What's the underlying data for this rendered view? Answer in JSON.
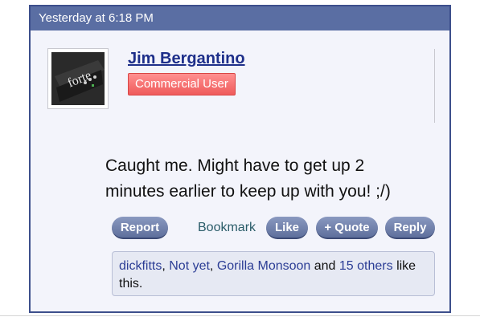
{
  "post": {
    "timestamp": "Yesterday at 6:18 PM",
    "author": {
      "name": "Jim Bergantino",
      "badge": "Commercial User",
      "avatar_icon": "amp-device-photo"
    },
    "message": "Caught me. Might have to get up 2 minutes earlier to keep up with you! ;/)",
    "actions": {
      "report": "Report",
      "bookmark": "Bookmark",
      "like": "Like",
      "quote": "+ Quote",
      "reply": "Reply"
    },
    "likes": {
      "users": [
        "dickfitts",
        "Not yet",
        "Gorilla Monsoon"
      ],
      "sep1": ", ",
      "sep2": ", ",
      "and_text": " and ",
      "others_link": "15 others",
      "suffix": " like this."
    }
  },
  "colors": {
    "header_bg": "#5a6ea3",
    "border": "#3d4f8c",
    "badge_bg": "#ef5b5b",
    "link": "#1e2f8a"
  }
}
